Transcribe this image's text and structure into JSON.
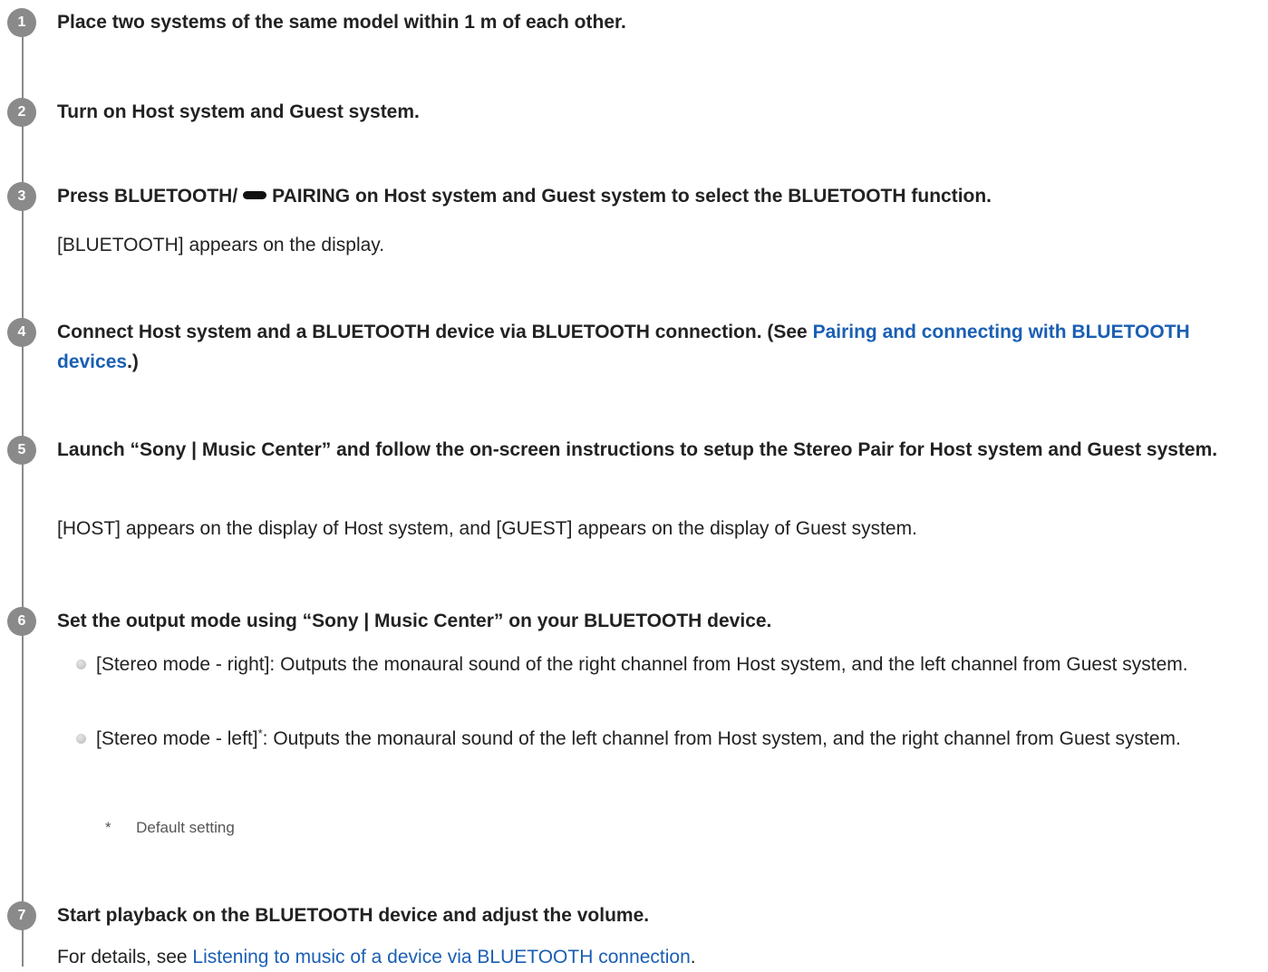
{
  "steps": [
    {
      "number": "1",
      "heading": "Place two systems of the same model within 1 m of each other."
    },
    {
      "number": "2",
      "heading": "Turn on Host system and Guest system."
    },
    {
      "number": "3",
      "heading_pre": "Press BLUETOOTH/",
      "icon": "pairing-pill-icon",
      "heading_post": "PAIRING on Host system and Guest system to select the BLUETOOTH function.",
      "body": "[BLUETOOTH] appears on the display."
    },
    {
      "number": "4",
      "heading_pre": "Connect Host system and a BLUETOOTH device via BLUETOOTH connection. (See ",
      "link": "Pairing and connecting with BLUETOOTH devices",
      "heading_post": ".)"
    },
    {
      "number": "5",
      "heading": "Launch “Sony | Music Center” and follow the on-screen instructions to setup the Stereo Pair for Host system and Guest system.",
      "body": "[HOST] appears on the display of Host system, and [GUEST] appears on the display of Guest system."
    },
    {
      "number": "6",
      "heading": "Set the output mode using “Sony | Music Center” on your BLUETOOTH device.",
      "bullets": [
        {
          "label": "[Stereo mode - right]",
          "text": ": Outputs the monaural sound of the right channel from Host system, and the left channel from Guest system."
        },
        {
          "label": "[Stereo mode - left]",
          "mark": "*",
          "text": ": Outputs the monaural sound of the left channel from Host system, and the right channel from Guest system."
        }
      ],
      "footnote_mark": "*",
      "footnote": "Default setting"
    },
    {
      "number": "7",
      "heading": "Start playback on the BLUETOOTH device and adjust the volume.",
      "body_pre": "For details, see ",
      "link": "Listening to music of a device via BLUETOOTH connection",
      "body_post": "."
    }
  ]
}
